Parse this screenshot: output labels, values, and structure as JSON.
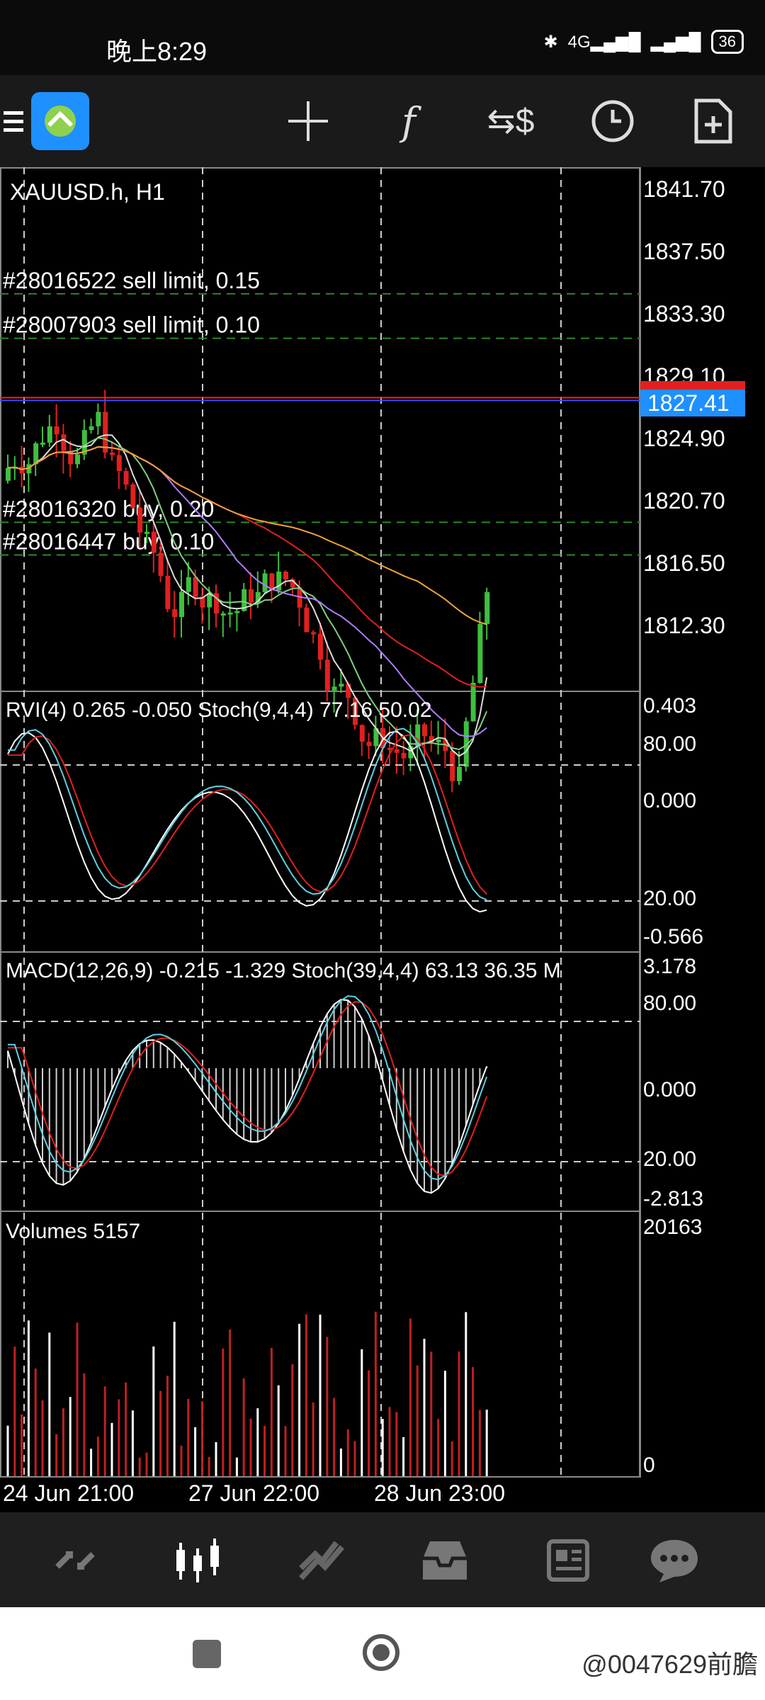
{
  "status_bar": {
    "time": "晚上8:29",
    "network": "4G",
    "battery": "36"
  },
  "toolbar": {
    "icons": [
      "menu-icon",
      "mt-logo-icon",
      "crosshair-icon",
      "indicators-icon",
      "symbol-icon",
      "timeframe-icon",
      "new-order-icon"
    ]
  },
  "chart": {
    "symbol_label": "XAUUSD.h, H1",
    "price_axis": [
      "1841.70",
      "1837.50",
      "1833.30",
      "1829.10",
      "1824.90",
      "1820.70",
      "1816.50",
      "1812.30"
    ],
    "current_price": "1827.41",
    "order_lines": [
      {
        "label": "#28016522 sell limit, 0.15",
        "price": 1834.6
      },
      {
        "label": "#28007903 sell limit, 0.10",
        "price": 1831.6
      },
      {
        "label": "#28016320 buy, 0.20",
        "price": 1819.2
      },
      {
        "label": "#28016447 buy, 0.10",
        "price": 1817.0
      }
    ],
    "colors": {
      "bull": "#3fbf3f",
      "bear": "#e02020",
      "bid_line": "#3050ff",
      "ask_line": "#ff2020",
      "price_tag": "#1e90ff"
    }
  },
  "rvi_panel": {
    "label": "RVI(4) 0.265 -0.050 Stoch(9,4,4) 77.16 50.02",
    "axis": [
      "0.403",
      "80.00",
      "0.000",
      "20.00",
      "-0.566"
    ]
  },
  "macd_panel": {
    "label": "MACD(12,26,9) -0.215 -1.329 Stoch(39,4,4) 63.13 36.35 M",
    "axis": [
      "3.178",
      "80.00",
      "0.000",
      "20.00",
      "-2.813"
    ]
  },
  "volume_panel": {
    "label": "Volumes 5157",
    "axis": [
      "20163",
      "0"
    ]
  },
  "time_axis": [
    "24 Jun 21:00",
    "27 Jun 22:00",
    "28 Jun 23:00"
  ],
  "bottom_nav": {
    "items": [
      "quotes-icon",
      "chart-icon",
      "trade-icon",
      "history-icon",
      "news-icon",
      "chat-icon"
    ]
  },
  "watermark": "@0047629前膽"
}
